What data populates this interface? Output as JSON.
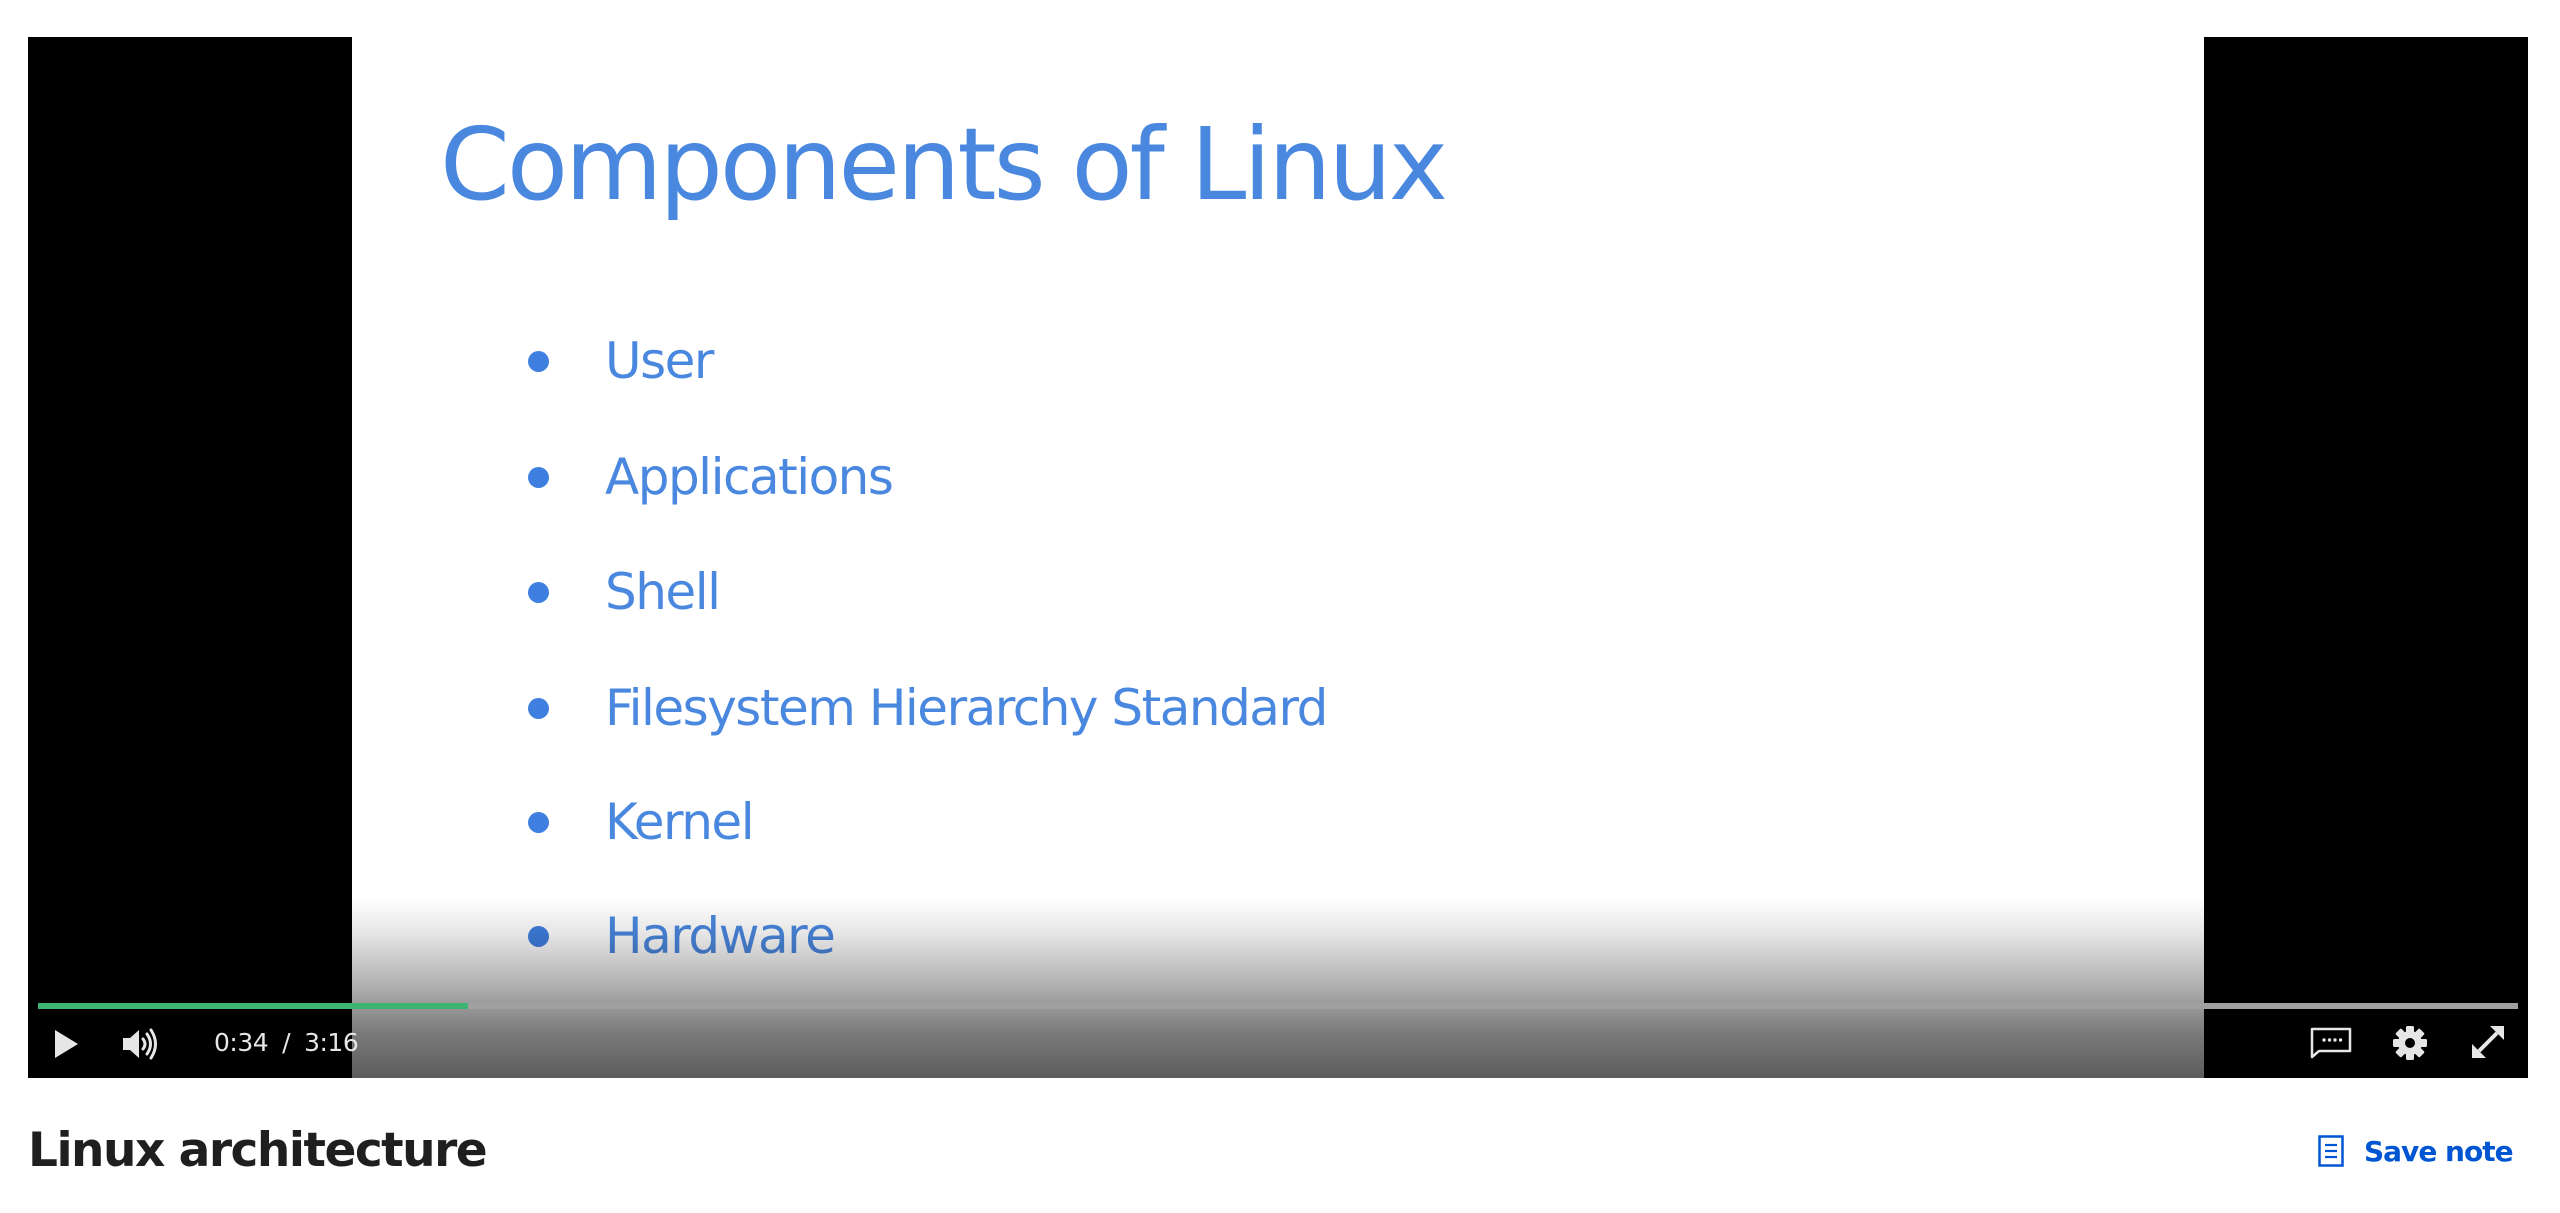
{
  "player": {
    "slide": {
      "title": "Components of Linux",
      "items": [
        {
          "label": "User"
        },
        {
          "label": "Applications"
        },
        {
          "label": "Shell"
        },
        {
          "label": "Filesystem Hierarchy Standard"
        },
        {
          "label": "Kernel"
        },
        {
          "label": "Hardware"
        }
      ],
      "text_color": "#4a88e0"
    },
    "state": "paused",
    "current_time": "0:34",
    "time_separator": "/",
    "duration": "3:16",
    "progress_fraction": 0.1735,
    "progress_color": "#3cb371",
    "controls": {
      "play_icon": "play-icon",
      "volume_icon": "volume-high-icon",
      "captions_icon": "captions-icon",
      "settings_icon": "gear-icon",
      "fullscreen_icon": "fullscreen-expand-icon"
    }
  },
  "lesson": {
    "title": "Linux architecture"
  },
  "actions": {
    "save_note_label": "Save note",
    "save_note_icon": "note-icon",
    "accent_color": "#0056d2"
  }
}
